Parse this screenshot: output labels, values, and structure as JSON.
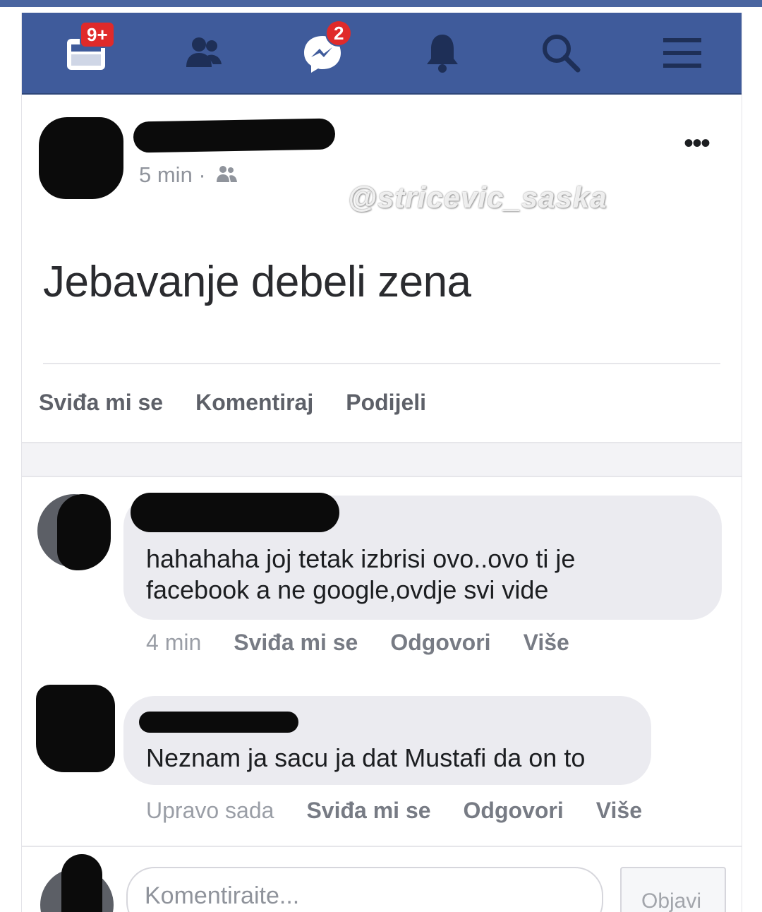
{
  "nav": {
    "items": [
      {
        "name": "feed-icon",
        "badge": "9+"
      },
      {
        "name": "friends-icon",
        "badge": ""
      },
      {
        "name": "messenger-icon",
        "badge": "2"
      },
      {
        "name": "notifications-bell-icon",
        "badge": ""
      },
      {
        "name": "search-icon",
        "badge": ""
      },
      {
        "name": "menu-icon",
        "badge": ""
      }
    ],
    "color": "#3f5b9b",
    "badge_color": "#e02a2a"
  },
  "post": {
    "time": "5 min ·",
    "privacy_icon": "friends-icon",
    "text": "Jebavanje debeli zena",
    "watermark": "@stricevic_saska",
    "actions": {
      "like": "Sviđa mi se",
      "comment": "Komentiraj",
      "share": "Podijeli"
    }
  },
  "comments": [
    {
      "text": "hahahaha joj tetak izbrisi ovo..ovo ti je facebook a ne google,ovdje svi vide",
      "time": "4 min",
      "like": "Sviđa mi se",
      "reply": "Odgovori",
      "more": "Više"
    },
    {
      "text": "Neznam ja sacu ja dat Mustafi da on to",
      "time": "Upravo sada",
      "like": "Sviđa mi se",
      "reply": "Odgovori",
      "more": "Više"
    }
  ],
  "composer": {
    "placeholder": "Komentiraite...",
    "submit": "Objavi"
  }
}
